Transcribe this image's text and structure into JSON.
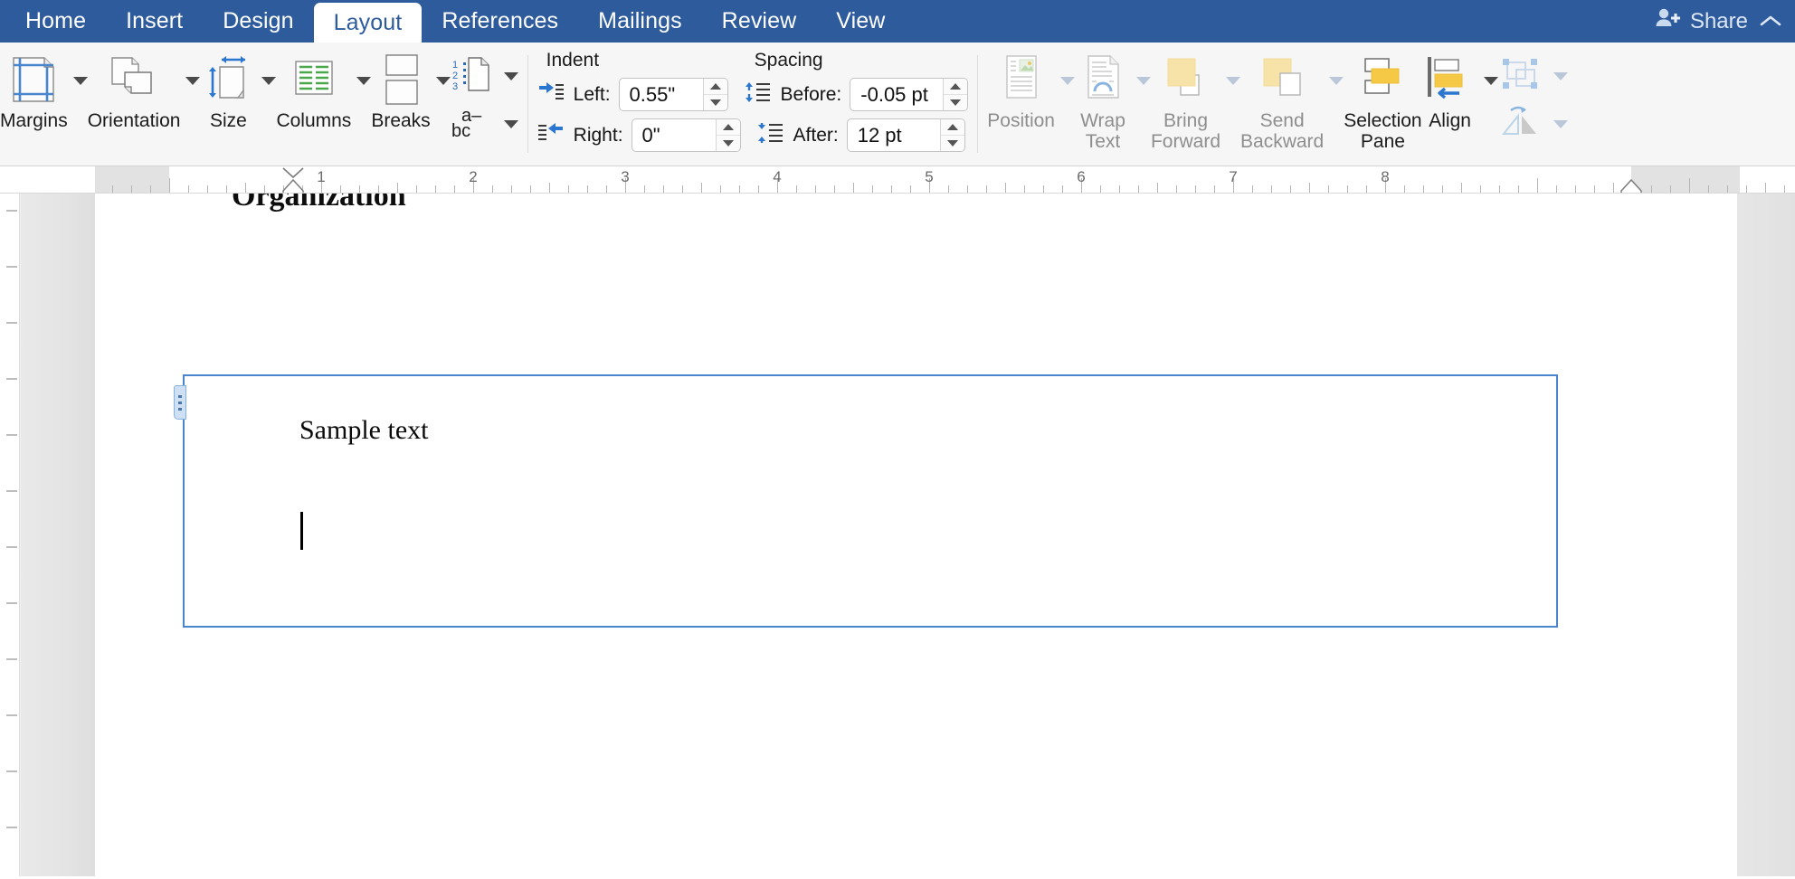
{
  "tabs": [
    {
      "label": "Home",
      "active": false
    },
    {
      "label": "Insert",
      "active": false
    },
    {
      "label": "Design",
      "active": false
    },
    {
      "label": "Layout",
      "active": true
    },
    {
      "label": "References",
      "active": false
    },
    {
      "label": "Mailings",
      "active": false
    },
    {
      "label": "Review",
      "active": false
    },
    {
      "label": "View",
      "active": false
    }
  ],
  "share": {
    "label": "Share",
    "icon": "person-plus-icon",
    "collapse_icon": "chevron-up-icon"
  },
  "ribbon": {
    "page_setup": [
      {
        "label": "Margins",
        "icon": "margins-icon",
        "caret": true,
        "enabled": true
      },
      {
        "label": "Orientation",
        "icon": "orientation-icon",
        "caret": true,
        "enabled": true
      },
      {
        "label": "Size",
        "icon": "size-icon",
        "caret": true,
        "enabled": true
      },
      {
        "label": "Columns",
        "icon": "columns-icon",
        "caret": true,
        "enabled": true
      },
      {
        "label": "Breaks",
        "icon": "breaks-icon",
        "caret": true,
        "enabled": true
      }
    ],
    "small_buttons": [
      {
        "name": "line-numbers-icon",
        "caret": true
      },
      {
        "name": "hyphenation-icon",
        "caret": true
      }
    ],
    "paragraph": {
      "indent_header": "Indent",
      "spacing_header": "Spacing",
      "left_label": "Left:",
      "left_value": "0.55\"",
      "right_label": "Right:",
      "right_value": "0\"",
      "before_label": "Before:",
      "before_value": "-0.05 pt",
      "after_label": "After:",
      "after_value": "12 pt",
      "left_icon": "indent-left-icon",
      "right_icon": "indent-right-icon",
      "before_icon": "spacing-before-icon",
      "after_icon": "spacing-after-icon"
    },
    "arrange": [
      {
        "label": "Position",
        "icon": "position-icon",
        "caret": true,
        "enabled": false
      },
      {
        "label": "Wrap\nText",
        "icon": "wrap-text-icon",
        "caret": true,
        "enabled": false
      },
      {
        "label": "Bring\nForward",
        "icon": "bring-forward-icon",
        "caret": true,
        "enabled": false
      },
      {
        "label": "Send\nBackward",
        "icon": "send-backward-icon",
        "caret": true,
        "enabled": false
      },
      {
        "label": "Selection\nPane",
        "icon": "selection-pane-icon",
        "caret": false,
        "enabled": true
      },
      {
        "label": "Align",
        "icon": "align-icon",
        "caret": true,
        "enabled": true
      }
    ],
    "arrange_small": [
      {
        "name": "group-objects-icon",
        "caret": true,
        "enabled": false
      },
      {
        "name": "rotate-objects-icon",
        "caret": true,
        "enabled": false
      }
    ]
  },
  "ruler": {
    "numbers": [
      "1",
      "2",
      "3",
      "4",
      "5",
      "6",
      "7",
      "8"
    ],
    "left_indent_marker": "first-line-indent-marker",
    "right_indent_marker": "right-indent-marker"
  },
  "document": {
    "clipped_heading": "Organization",
    "textbox_text": "Sample text",
    "caret": "text-cursor"
  },
  "colors": {
    "ribbon_accent": "#2e5b9c",
    "tab_active_text": "#2e5b9c",
    "textbox_border": "#4a86cd",
    "canvas_bg": "#f1f1f1"
  }
}
